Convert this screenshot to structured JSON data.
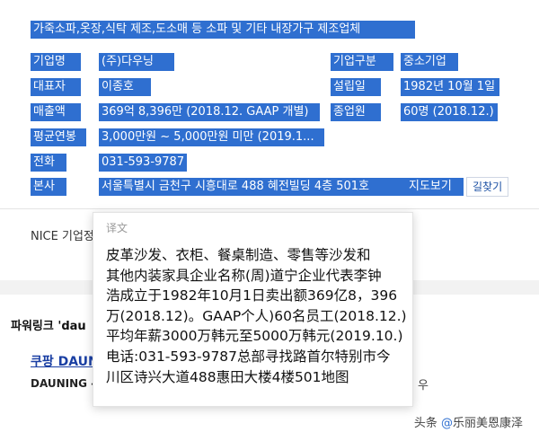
{
  "header": "가죽소파,옷장,식탁 제조,도소매 등 소파 및 기타 내장가구 제조업체",
  "company_rows": [
    {
      "label": "기업명",
      "value": "(주)다우닝"
    },
    {
      "label": "대표자",
      "value": "이종호"
    },
    {
      "label": "매출액",
      "value": "369억 8,396만 (2018.12. GAAP 개별)"
    },
    {
      "label": "평균연봉",
      "value": "3,000만원 ~ 5,000만원 미만 (2019.1..."
    },
    {
      "label": "전화",
      "value": "031-593-9787"
    },
    {
      "label": "본사",
      "value": "서울특별시 금천구 시흥대로 488 혜전빌딩 4층 501호"
    }
  ],
  "right_rows": [
    {
      "label": "기업구분",
      "value": "중소기업"
    },
    {
      "label": "설립일",
      "value": "1982년 10월 1일"
    },
    {
      "label": "종업원",
      "value": "60명 (2018.12.)"
    }
  ],
  "map_link": "지도보기",
  "directions_button": "길찾기",
  "background": {
    "nice_label": "NICE 기업정",
    "powerlink_label": "파워링크 'dau",
    "coupang_label": "쿠팡 DAUN",
    "dauning_label": "DAUNING -",
    "trailing_char": "우"
  },
  "translation_popup": {
    "title": "译文",
    "text": "皮革沙发、衣柜、餐桌制造、零售等沙发和\n其他内装家具企业名称(周)道宁企业代表李钟\n浩成立于1982年10月1日卖出额369亿8，396\n万(2018.12)。GAAP个人)60名员工(2018.12.)\n平均年薪3000万韩元至5000万韩元(2019.10.)\n电话:031-593-9787总部寻找路首尔特别市今\n川区诗兴大道488惠田大楼4楼501地图"
  },
  "watermark": {
    "prefix": "头条 ",
    "at": "@",
    "name": "乐丽美恩康泽"
  },
  "colors": {
    "selection": "#2f6fd0",
    "link": "#1a4fa3"
  }
}
